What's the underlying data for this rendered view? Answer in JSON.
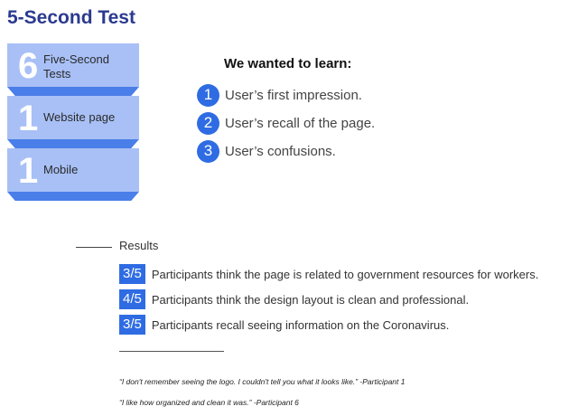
{
  "title": "5-Second Test",
  "cards": [
    {
      "number": "6",
      "label": "Five-Second Tests"
    },
    {
      "number": "1",
      "label": "Website page"
    },
    {
      "number": "1",
      "label": "Mobile"
    }
  ],
  "learn": {
    "heading": "We wanted to learn:",
    "items": [
      {
        "number": "1",
        "text": "User’s first impression."
      },
      {
        "number": "2",
        "text": "User’s recall of the page."
      },
      {
        "number": "3",
        "text": "User’s confusions."
      }
    ]
  },
  "results": {
    "label": "Results",
    "items": [
      {
        "badge": "3/5",
        "text": "Participants think the page is related to government resources for workers."
      },
      {
        "badge": "4/5",
        "text": "Participants think the design layout is clean and professional."
      },
      {
        "badge": "3/5",
        "text": "Participants recall seeing information on the Coronavirus."
      }
    ]
  },
  "quotes": [
    "“I don't remember seeing the logo. I couldn't tell you what it looks like.” -Participant 1",
    "“I like how organized and clean it was.” -Participant 6"
  ],
  "colors": {
    "accent": "#2f6ce3",
    "title": "#2b3a8f",
    "card": "#a8c0f6",
    "fold": "#4a7ee8"
  }
}
